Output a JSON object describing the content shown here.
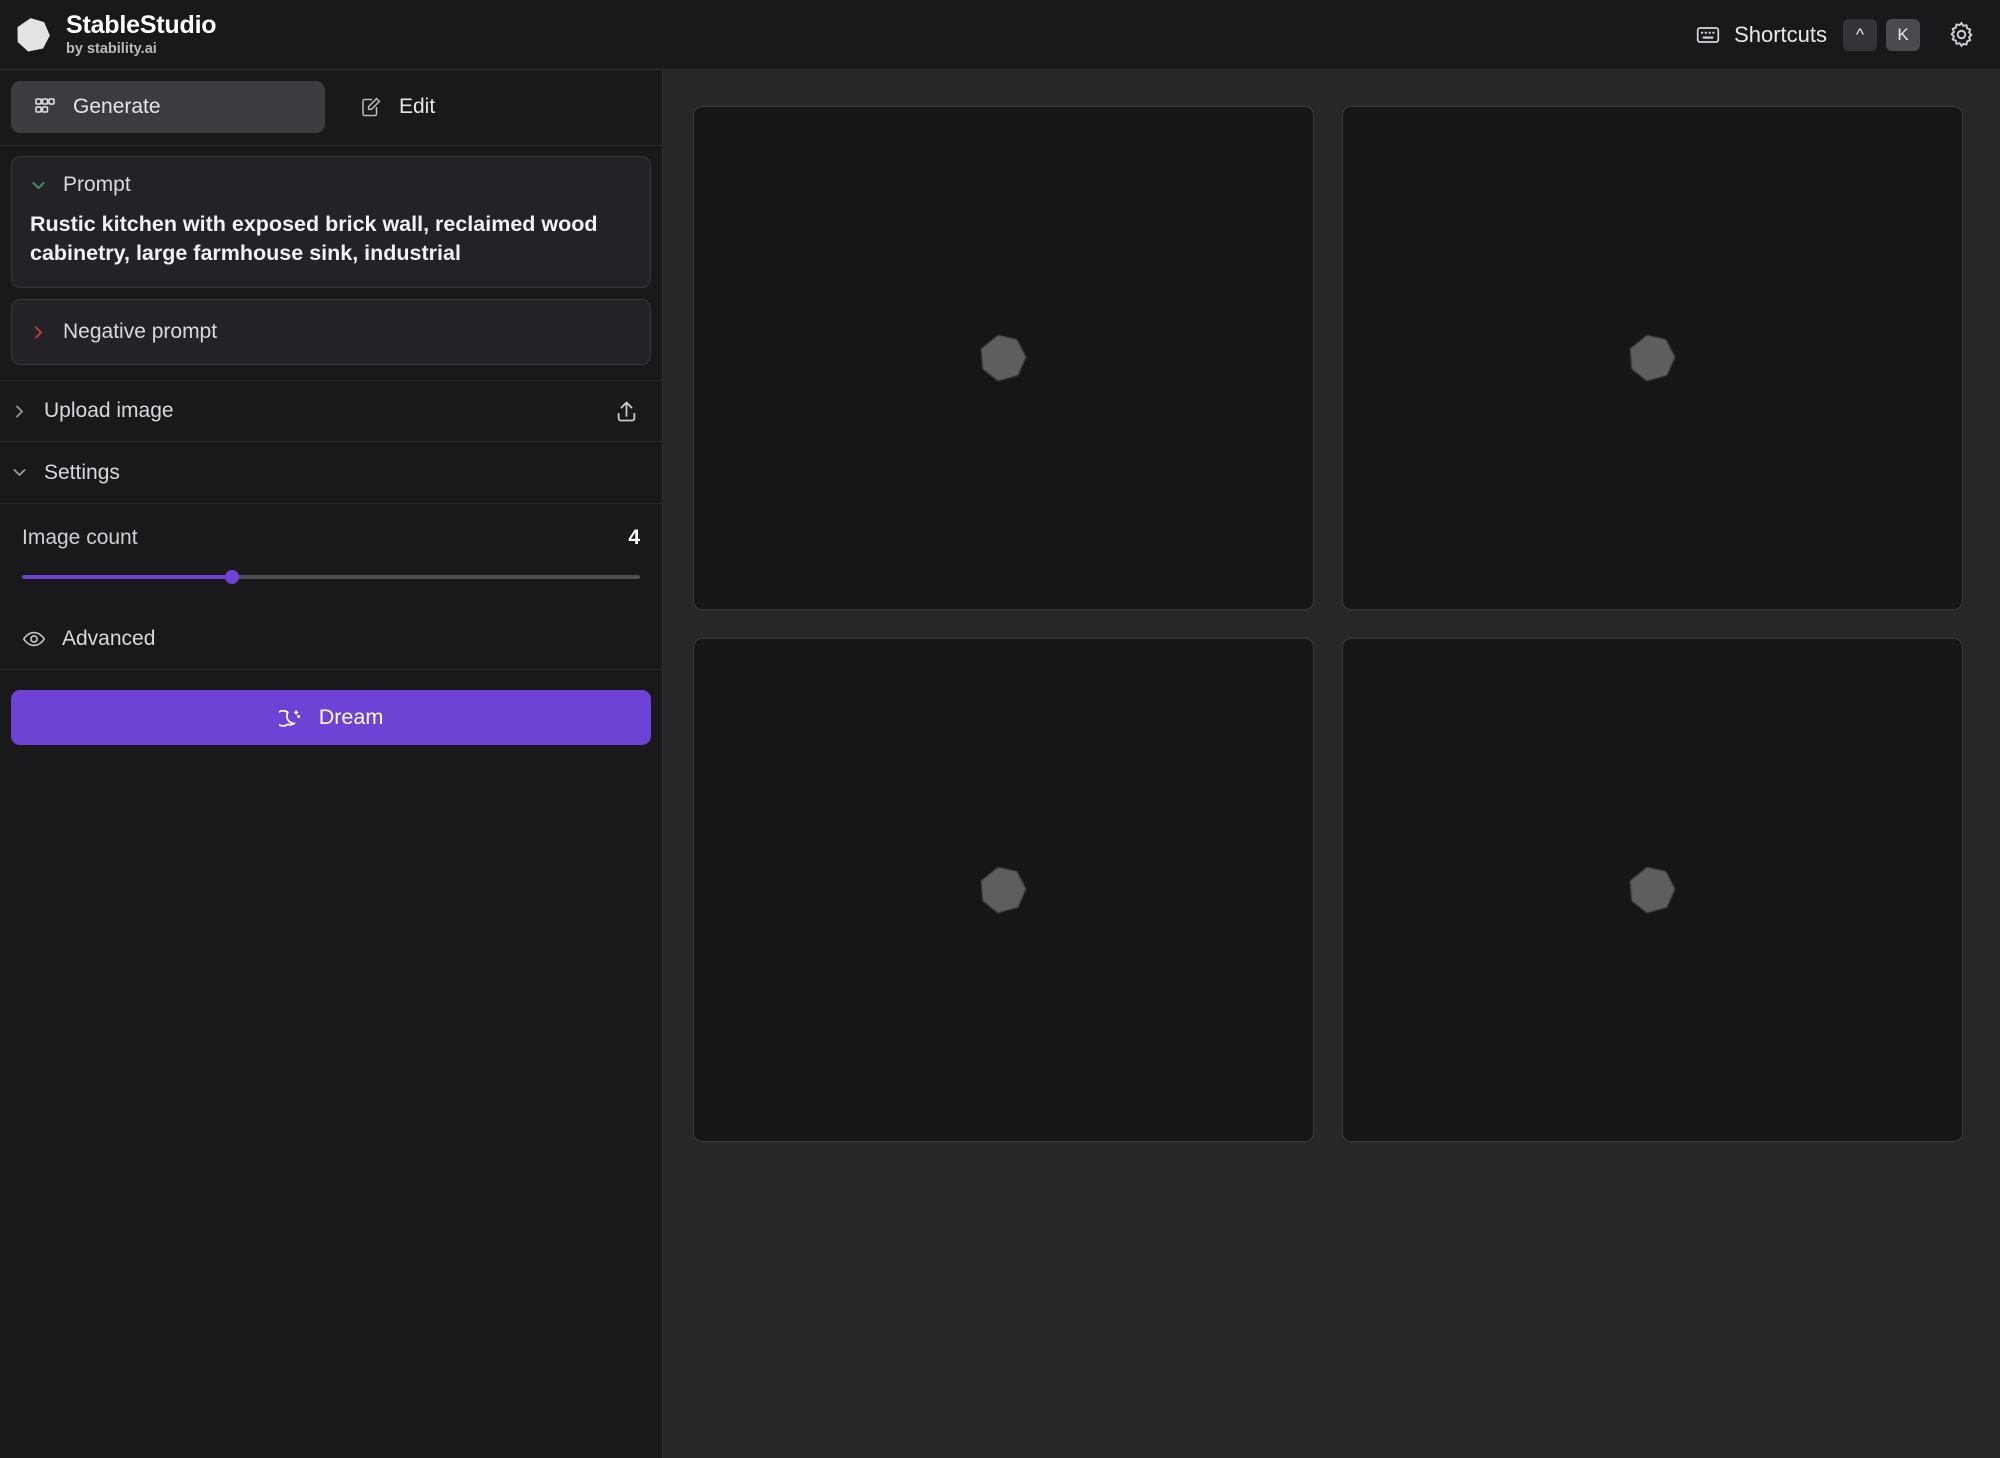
{
  "header": {
    "brand_title": "StableStudio",
    "brand_subtitle": "by stability.ai",
    "logo_icon": "heptagon-logo",
    "keyboard_icon": "keyboard-icon",
    "shortcuts_label": "Shortcuts",
    "keycaps": [
      {
        "label": "^",
        "style": "dim"
      },
      {
        "label": "K",
        "style": "lite"
      }
    ],
    "settings_icon": "gear-icon"
  },
  "sidebar": {
    "tabs": [
      {
        "label": "Generate",
        "icon": "grid-squares-icon",
        "active": true
      },
      {
        "label": "Edit",
        "icon": "pencil-square-icon",
        "active": false
      }
    ],
    "prompt": {
      "title": "Prompt",
      "chevron": "chevron-down-icon",
      "chevron_color": "#3f8f5c",
      "expanded": true,
      "text": "Rustic kitchen with exposed brick wall, reclaimed wood cabinetry, large farmhouse sink, industrial"
    },
    "negative_prompt": {
      "title": "Negative prompt",
      "chevron": "chevron-right-icon",
      "chevron_color": "#c0392b",
      "expanded": false
    },
    "upload_image": {
      "title": "Upload image",
      "chevron": "chevron-right-icon",
      "chevron_color": "#9a9aa2",
      "action_icon": "upload-icon",
      "expanded": false
    },
    "settings": {
      "title": "Settings",
      "chevron": "chevron-down-icon",
      "chevron_color": "#9a9aa2",
      "expanded": true,
      "image_count": {
        "label": "Image count",
        "value": "4",
        "slider_percent": 34,
        "accent_color": "#6d42d4"
      },
      "advanced": {
        "label": "Advanced",
        "icon": "eye-icon"
      }
    },
    "dream_button": {
      "label": "Dream",
      "icon": "moon-sparkle-icon",
      "color": "#6d42d4"
    }
  },
  "canvas": {
    "tiles": [
      {
        "state": "loading",
        "placeholder_icon": "heptagon-placeholder-icon"
      },
      {
        "state": "loading",
        "placeholder_icon": "heptagon-placeholder-icon"
      },
      {
        "state": "loading",
        "placeholder_icon": "heptagon-placeholder-icon"
      },
      {
        "state": "loading",
        "placeholder_icon": "heptagon-placeholder-icon"
      }
    ]
  }
}
